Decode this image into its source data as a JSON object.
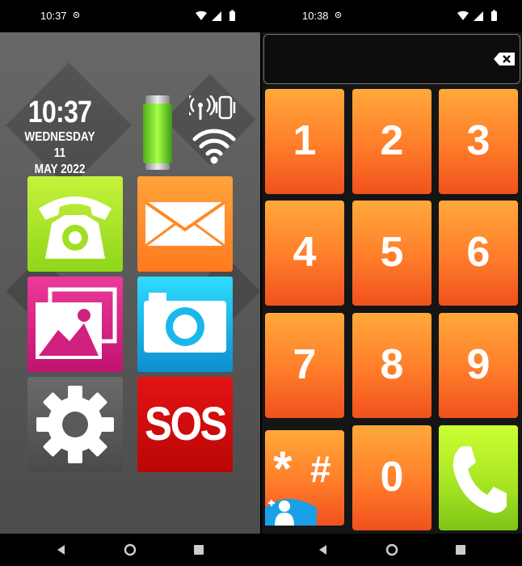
{
  "launcher": {
    "status": {
      "time": "10:37"
    },
    "clock": {
      "time": "10:37",
      "day": "WEDNESDAY 11",
      "month_year": "MAY 2022"
    },
    "tiles": [
      {
        "id": "phone",
        "icon": "telephone-icon",
        "color": "#9fe022"
      },
      {
        "id": "messages",
        "icon": "envelope-icon",
        "color": "#ff8a25"
      },
      {
        "id": "gallery",
        "icon": "gallery-icon",
        "color": "#d0217e"
      },
      {
        "id": "camera",
        "icon": "camera-icon",
        "color": "#1bb7ec"
      },
      {
        "id": "settings",
        "icon": "gear-icon",
        "color": "#5e5e5e"
      },
      {
        "id": "sos",
        "label": "SOS",
        "color": "#d50d0d"
      }
    ],
    "widgets": {
      "battery_icon": "battery-icon",
      "signal_icon": "signal-icon",
      "wifi_icon": "wifi-icon"
    }
  },
  "dialer": {
    "status": {
      "time": "10:38"
    },
    "display_value": "",
    "keys": [
      "1",
      "2",
      "3",
      "4",
      "5",
      "6",
      "7",
      "8",
      "9",
      "*",
      "#",
      "0"
    ],
    "accent": "#ff7c2a",
    "call_color": "#a4e322"
  }
}
